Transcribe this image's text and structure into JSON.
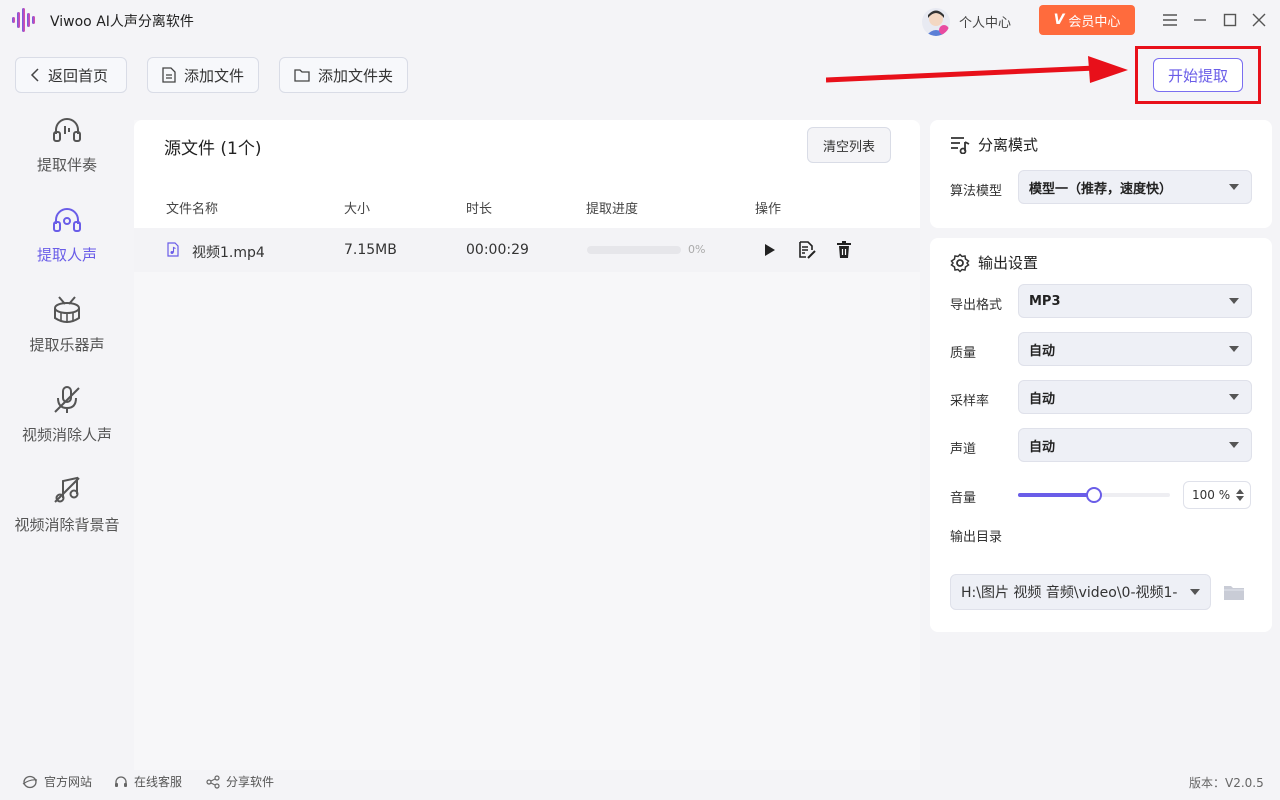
{
  "app": {
    "title": "Viwoo AI人声分离软件",
    "user_center": "个人中心",
    "vip_label": "会员中心",
    "vip_badge": "V"
  },
  "toolbar": {
    "back": "返回首页",
    "add_file": "添加文件",
    "add_folder": "添加文件夹",
    "start": "开始提取"
  },
  "sidebar": {
    "items": [
      {
        "label": "提取伴奏",
        "icon": "headphones-icon",
        "active": false
      },
      {
        "label": "提取人声",
        "icon": "vocal-headphones-icon",
        "active": true
      },
      {
        "label": "提取乐器声",
        "icon": "drum-icon",
        "active": false
      },
      {
        "label": "视频消除人声",
        "icon": "mic-off-icon",
        "active": false
      },
      {
        "label": "视频消除背景音",
        "icon": "music-off-icon",
        "active": false
      }
    ]
  },
  "file_list": {
    "title": "源文件 (1个)",
    "clear_btn": "清空列表",
    "headers": {
      "name": "文件名称",
      "size": "大小",
      "duration": "时长",
      "progress": "提取进度",
      "actions": "操作"
    },
    "rows": [
      {
        "name": "视频1.mp4",
        "size": "7.15MB",
        "duration": "00:00:29",
        "progress": 0,
        "progress_text": "0%"
      }
    ]
  },
  "separation": {
    "title": "分离模式",
    "model_label": "算法模型",
    "model_value": "模型一（推荐，速度快）"
  },
  "output": {
    "title": "输出设置",
    "format_label": "导出格式",
    "format_value": "MP3",
    "quality_label": "质量",
    "quality_value": "自动",
    "rate_label": "采样率",
    "rate_value": "自动",
    "channel_label": "声道",
    "channel_value": "自动",
    "volume_label": "音量",
    "volume_value": 100,
    "volume_text": "100 %",
    "dir_label": "输出目录",
    "dir_value": "H:\\图片 视频 音频\\video\\0-视频1-"
  },
  "footer": {
    "website": "官方网站",
    "support": "在线客服",
    "share": "分享软件",
    "version": "版本：V2.0.5"
  },
  "colors": {
    "accent": "#6a5de8",
    "vip": "#ff6b3d",
    "highlight": "#e8101a"
  }
}
